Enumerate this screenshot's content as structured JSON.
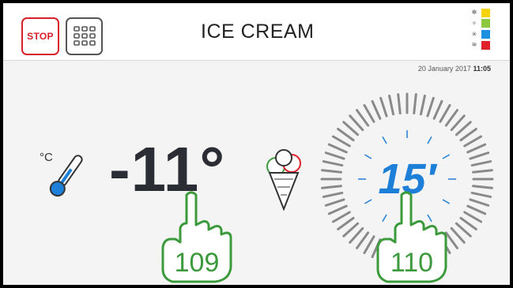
{
  "header": {
    "stop_label": "STOP",
    "title": "ICE CREAM",
    "date": "20 January 2017",
    "time": "11:05"
  },
  "modes": [
    {
      "icon": "fan-icon",
      "color": "#f5d40c"
    },
    {
      "icon": "sparkle-icon",
      "color": "#8dc63f"
    },
    {
      "icon": "snowflake-icon",
      "color": "#1e90e0"
    },
    {
      "icon": "heat-icon",
      "color": "#e0202a"
    }
  ],
  "main": {
    "temperature": "-11°",
    "timer": "15′"
  },
  "annotations": {
    "left_touch": "109",
    "right_touch": "110"
  },
  "colors": {
    "accent_red": "#d8202a",
    "timer_blue": "#1e7fd8",
    "touch_green": "#3c9a3c"
  }
}
